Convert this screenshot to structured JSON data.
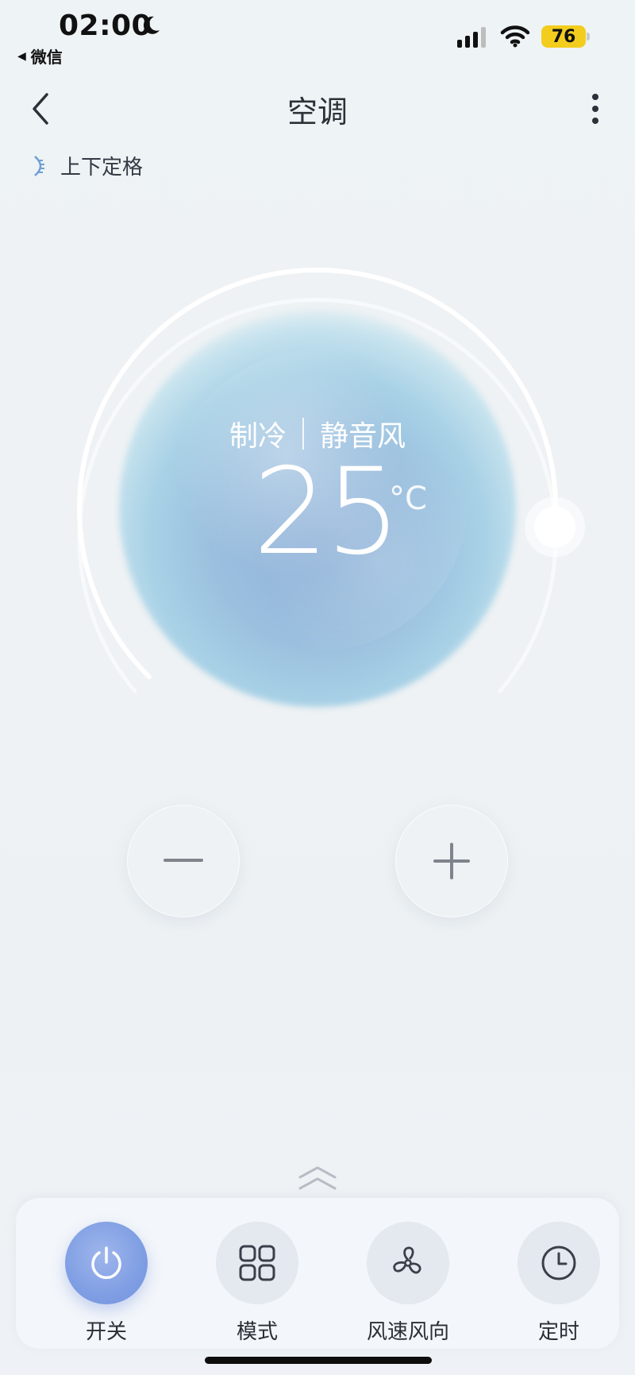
{
  "status_bar": {
    "time": "02:00",
    "back_app": "微信",
    "battery": "76",
    "icons": [
      "moon-icon",
      "signal-icon",
      "wifi-icon",
      "battery-icon"
    ]
  },
  "header": {
    "title": "空调",
    "back_icon": "chevron-left-icon",
    "more_icon": "more-vertical-icon"
  },
  "swing": {
    "label": "上下定格",
    "icon": "swing-vertical-icon"
  },
  "dial": {
    "mode": "制冷",
    "fan": "静音风",
    "temperature": "25",
    "unit": "°C",
    "knob_level": 0.85
  },
  "temperature_controls": {
    "decrease_icon": "minus-icon",
    "increase_icon": "plus-icon"
  },
  "controls": [
    {
      "label": "开关",
      "icon": "power-icon",
      "active": true
    },
    {
      "label": "模式",
      "icon": "grid-icon",
      "active": false
    },
    {
      "label": "风速风向",
      "icon": "fan-icon",
      "active": false
    },
    {
      "label": "定时",
      "icon": "clock-icon",
      "active": false
    }
  ],
  "colors": {
    "accent": "#7f9ee3",
    "battery": "#f3cd1e",
    "dial_core": "#8fb1d8"
  }
}
